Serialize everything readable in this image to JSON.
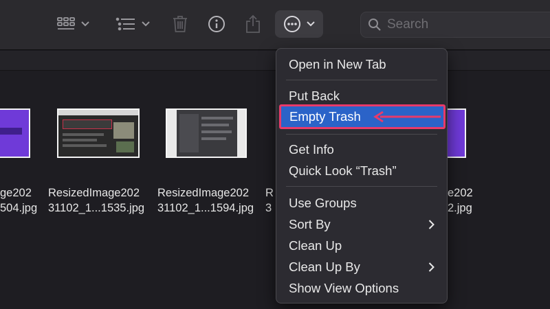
{
  "toolbar": {
    "search_placeholder": "Search",
    "icons": [
      "grid-view-icon",
      "list-view-icon",
      "trash-icon",
      "info-icon",
      "share-icon",
      "more-icon"
    ]
  },
  "files": [
    {
      "line1": "ge202",
      "line2": "504.jpg"
    },
    {
      "line1": "ResizedImage202",
      "line2": "31102_1...1535.jpg"
    },
    {
      "line1": "ResizedImage202",
      "line2": "31102_1...1594.jpg"
    },
    {
      "line1": "R",
      "line2": "3"
    },
    {
      "line1": "e202",
      "line2": "2.jpg"
    }
  ],
  "menu": {
    "items": [
      {
        "label": "Open in New Tab"
      },
      {
        "label": "Put Back"
      },
      {
        "label": "Empty Trash"
      },
      {
        "label": "Get Info"
      },
      {
        "label": "Quick Look “Trash”"
      },
      {
        "label": "Use Groups"
      },
      {
        "label": "Sort By",
        "submenu": true
      },
      {
        "label": "Clean Up"
      },
      {
        "label": "Clean Up By",
        "submenu": true
      },
      {
        "label": "Show View Options"
      }
    ],
    "highlighted": "Empty Trash",
    "highlight_color": "#2b63c8",
    "annotation_color": "#e83a6a"
  }
}
